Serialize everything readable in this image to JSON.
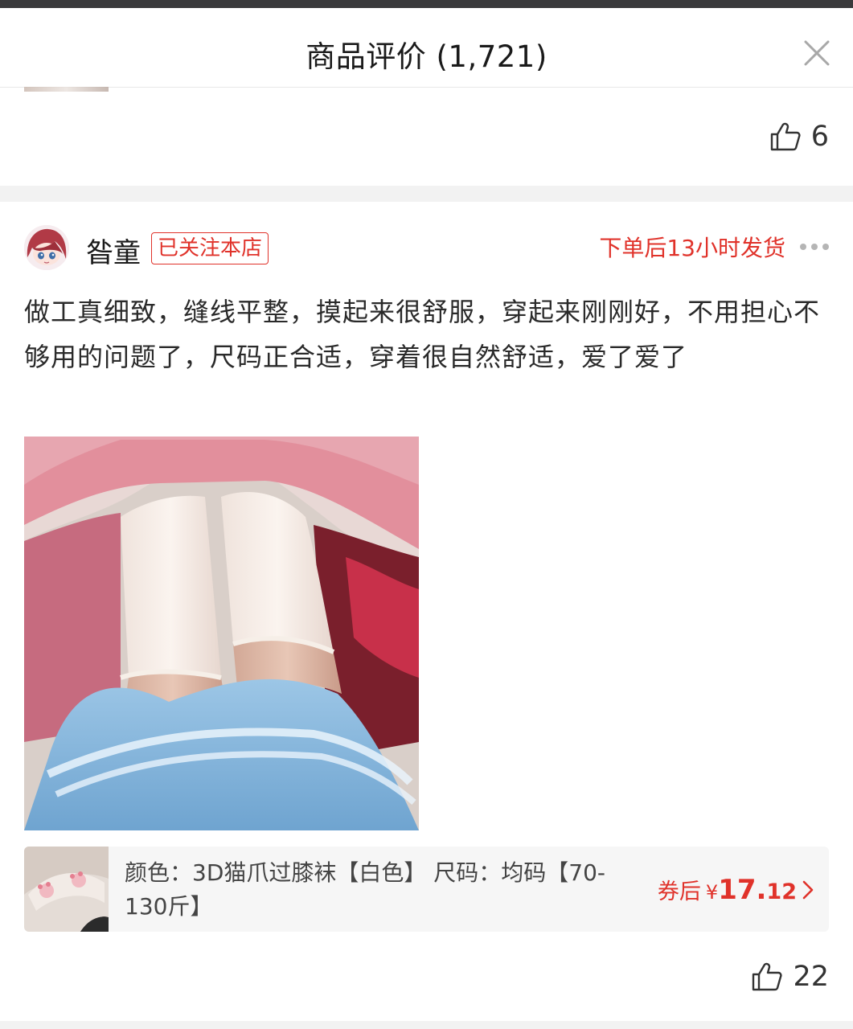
{
  "header": {
    "title": "商品评价 (1,721)"
  },
  "previous_review": {
    "like_count": "6"
  },
  "review": {
    "username": "昝童",
    "follow_badge": "已关注本店",
    "ship_time": "下单后13小时发货",
    "text": "做工真细致，缝线平整，摸起来很舒服，穿起来刚刚好，不用担心不够用的问题了，尺码正合适，穿着很自然舒适，爱了爱了",
    "sku": {
      "description": "颜色：3D猫爪过膝袜【白色】 尺码：均码【70-130斤】",
      "price_prefix": "券后",
      "currency": "¥",
      "price_int": "17.",
      "price_dec": "12"
    },
    "like_count": "22"
  },
  "colors": {
    "accent": "#e0322a",
    "text": "#2a2a2a",
    "divider": "#f2f2f2"
  },
  "icons": {
    "close": "close-icon",
    "like": "thumbs-up-icon",
    "more": "more-dots-icon",
    "chevron": "chevron-right-icon"
  }
}
